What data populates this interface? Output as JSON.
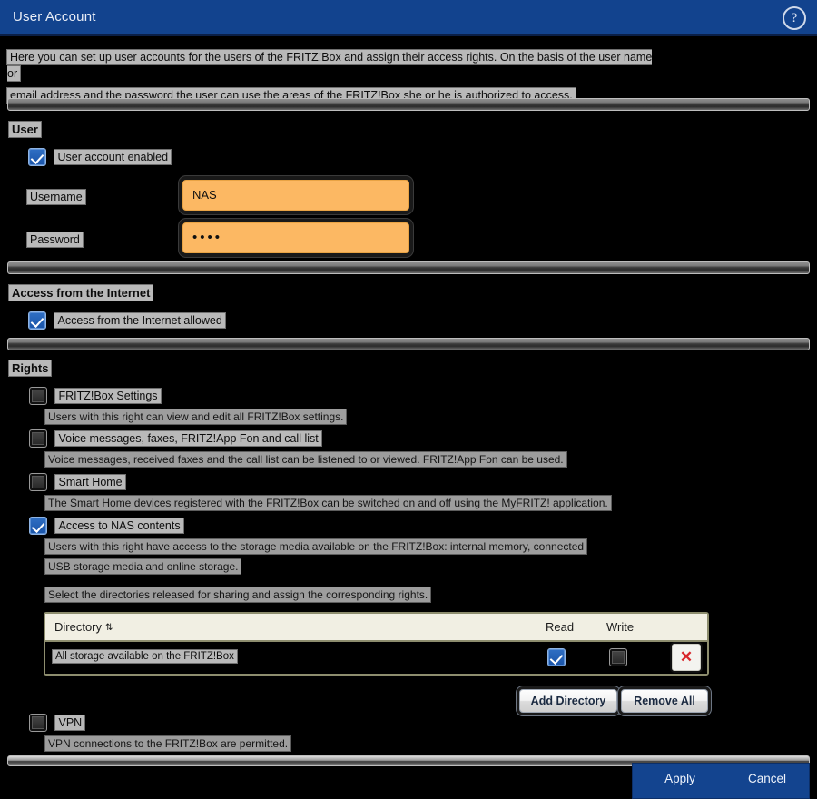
{
  "window": {
    "title": "User Account",
    "help_icon": "help-circle-icon",
    "help_glyph": "?"
  },
  "intro": {
    "line1": "Here you can set up user accounts for the users of the FRITZ!Box and assign their access rights. On the basis of the user name or",
    "line2": "email address and the password the user can use the areas of the FRITZ!Box she or he is authorized to access."
  },
  "user_section": {
    "heading": "User",
    "account_enabled_label": "User account enabled",
    "account_enabled_checked": true,
    "username_label": "Username",
    "username_value": "NAS",
    "password_label": "Password",
    "password_value": "••••"
  },
  "internet_section": {
    "heading": "Access from the Internet",
    "allowed_label": "Access from the Internet allowed",
    "allowed_checked": true
  },
  "rights_section": {
    "heading": "Rights",
    "items": [
      {
        "label": "FRITZ!Box Settings",
        "checked": false,
        "description_lines": [
          "Users with this right can view and edit all FRITZ!Box settings."
        ]
      },
      {
        "label": "Voice messages, faxes, FRITZ!App Fon and call list",
        "checked": false,
        "description_lines": [
          "Voice messages, received faxes and the call list can be listened to or viewed. FRITZ!App Fon can be used."
        ]
      },
      {
        "label": "Smart Home",
        "checked": false,
        "description_lines": [
          "The Smart Home devices registered with the FRITZ!Box can be switched on and off using the MyFRITZ! application."
        ]
      },
      {
        "label": "Access to NAS contents",
        "checked": true,
        "description_lines": [
          "Users with this right have access to the storage media available on the FRITZ!Box: internal memory, connected",
          "USB storage media and online storage."
        ]
      }
    ],
    "nas_hint": "Select the directories released for sharing and assign the corresponding rights.",
    "vpn": {
      "label": "VPN",
      "checked": false,
      "description_lines": [
        "VPN connections to the FRITZ!Box are permitted."
      ]
    }
  },
  "directory_table": {
    "columns": {
      "directory": "Directory",
      "read": "Read",
      "write": "Write"
    },
    "sort_glyph": "⇅",
    "rows": [
      {
        "name": "All storage available on the FRITZ!Box",
        "read": true,
        "write": false,
        "delete_glyph": "✕"
      }
    ],
    "add_button": "Add Directory",
    "remove_button": "Remove All"
  },
  "actions": {
    "apply": "Apply",
    "cancel": "Cancel"
  },
  "colors": {
    "header_blue": "#12438e",
    "input_orange": "#fcb863",
    "checkbox_blue": "#1a54a8",
    "delete_red": "#d8262a",
    "selection_gray": "#b9b9b9"
  }
}
